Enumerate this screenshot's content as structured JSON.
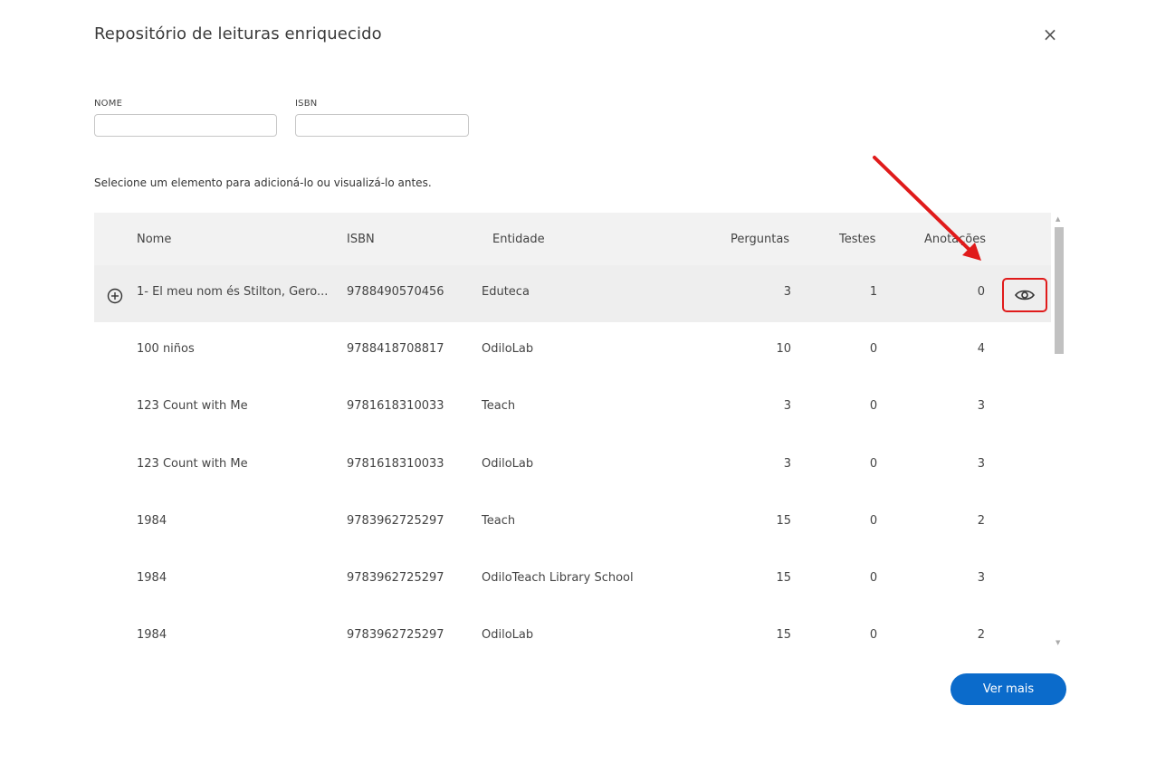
{
  "dialog": {
    "title": "Repositório de leituras enriquecido",
    "close_icon": "close-icon",
    "close_glyph": "×"
  },
  "filters": {
    "name_label": "NOME",
    "name_value": "",
    "isbn_label": "ISBN",
    "isbn_value": ""
  },
  "instructions": "Selecione um elemento para adicioná-lo ou visualizá-lo antes.",
  "table": {
    "headers": {
      "name": "Nome",
      "isbn": "ISBN",
      "entity": "Entidade",
      "questions": "Perguntas",
      "tests": "Testes",
      "annotations": "Anotações"
    },
    "rows": [
      {
        "name": "1- El meu nom és Stilton, Gero...",
        "isbn": "9788490570456",
        "entity": "Eduteca",
        "questions": "3",
        "tests": "1",
        "annotations": "0"
      },
      {
        "name": "100 niños",
        "isbn": "9788418708817",
        "entity": "OdiloLab",
        "questions": "10",
        "tests": "0",
        "annotations": "4"
      },
      {
        "name": "123 Count with Me",
        "isbn": "9781618310033",
        "entity": "Teach",
        "questions": "3",
        "tests": "0",
        "annotations": "3"
      },
      {
        "name": "123 Count with Me",
        "isbn": "9781618310033",
        "entity": "OdiloLab",
        "questions": "3",
        "tests": "0",
        "annotations": "3"
      },
      {
        "name": "1984",
        "isbn": "9783962725297",
        "entity": "Teach",
        "questions": "15",
        "tests": "0",
        "annotations": "2"
      },
      {
        "name": "1984",
        "isbn": "9783962725297",
        "entity": "OdiloTeach Library School",
        "questions": "15",
        "tests": "0",
        "annotations": "3"
      },
      {
        "name": "1984",
        "isbn": "9783962725297",
        "entity": "OdiloLab",
        "questions": "15",
        "tests": "0",
        "annotations": "2"
      }
    ]
  },
  "actions": {
    "more_label": "Ver mais"
  },
  "icons": {
    "add": "plus-circle-icon",
    "preview": "eye-icon"
  },
  "colors": {
    "primary_button": "#0b6bcb",
    "annotation_red": "#e01b1b",
    "hover_row": "#eeeeee",
    "header_bg": "#f2f2f2"
  }
}
